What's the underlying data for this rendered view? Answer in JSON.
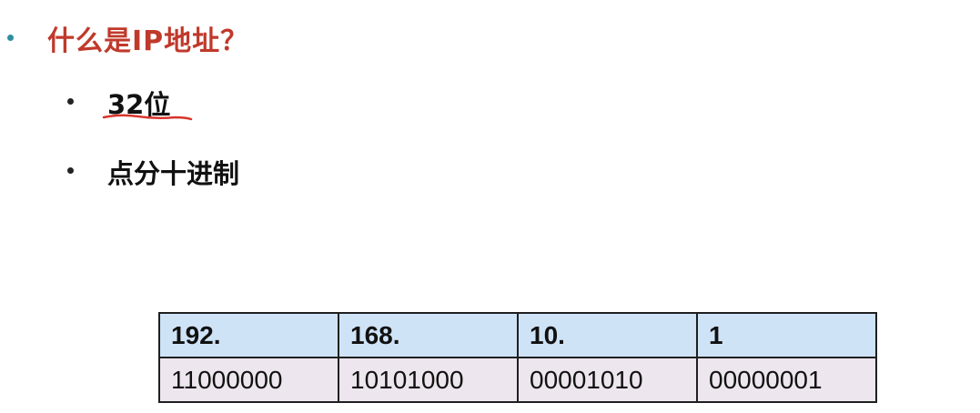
{
  "slide": {
    "title": "什么是IP地址？",
    "bullets": [
      {
        "text": "32位",
        "underlined": true
      },
      {
        "text": "点分十进制",
        "underlined": false
      }
    ]
  },
  "ip_table": {
    "dotted_row": [
      "192.",
      "168.",
      "10.",
      "1"
    ],
    "binary_row": [
      "11000000",
      "10101000",
      "00001010",
      "00000001"
    ]
  },
  "colors": {
    "title": "#c0392b",
    "title_bullet": "#2f8fa0",
    "underline": "#d9342b",
    "header_row_bg": "#cfe3f7",
    "binary_row_bg": "#ede6ee"
  }
}
